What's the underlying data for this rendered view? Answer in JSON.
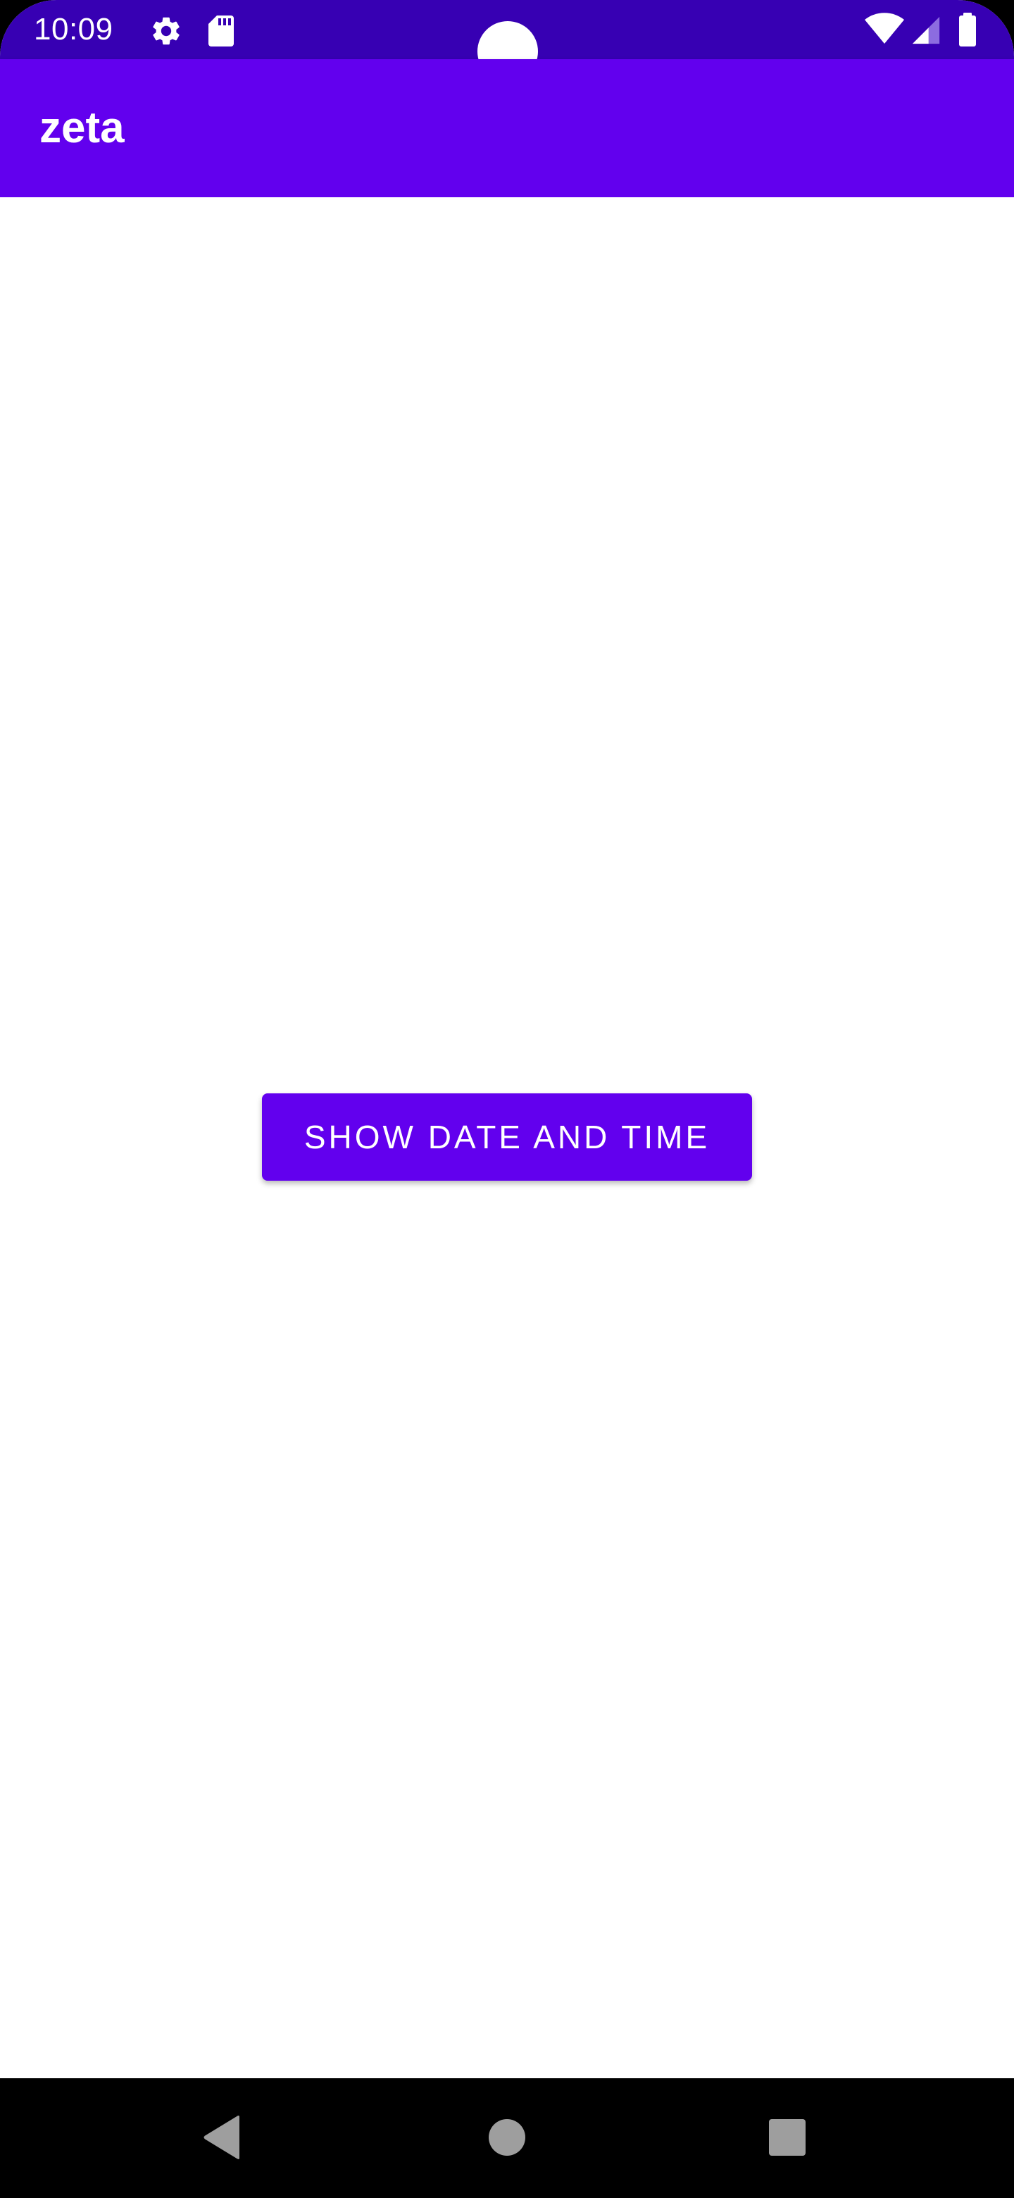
{
  "status_bar": {
    "time": "10:09",
    "icons": [
      "settings-icon",
      "sd-card-icon",
      "wifi-icon",
      "cell-signal-icon",
      "battery-icon"
    ],
    "background_color": "#3700B3"
  },
  "app_bar": {
    "title": "zeta",
    "background_color": "#6200EE"
  },
  "main": {
    "button_label": "SHOW DATE AND TIME",
    "button_color": "#6200EE"
  },
  "nav_bar": {
    "buttons": [
      "back-icon",
      "home-icon",
      "recents-icon"
    ],
    "icon_color": "#9E9E9E"
  }
}
